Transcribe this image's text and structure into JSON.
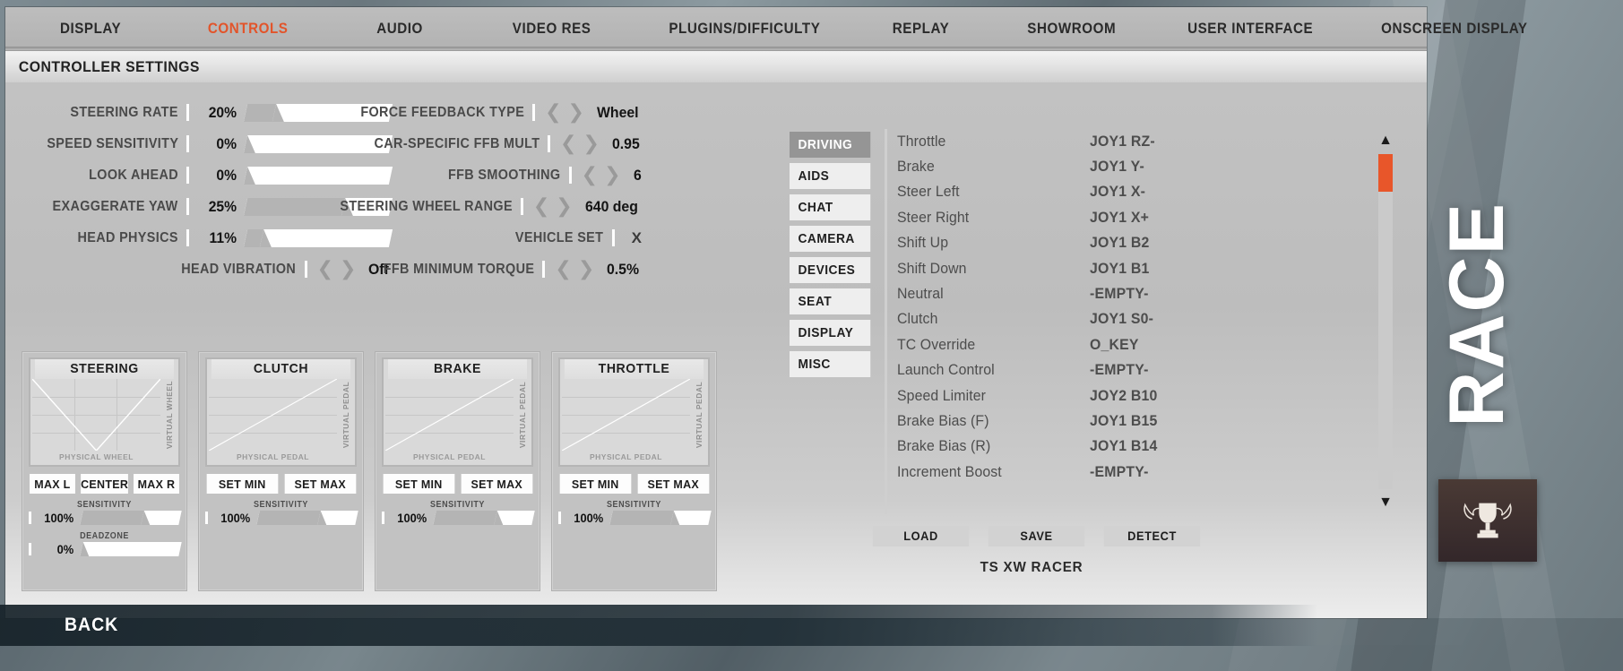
{
  "tabs": [
    {
      "label": "DISPLAY",
      "active": false
    },
    {
      "label": "CONTROLS",
      "active": true
    },
    {
      "label": "AUDIO",
      "active": false
    },
    {
      "label": "VIDEO RES",
      "active": false
    },
    {
      "label": "PLUGINS/DIFFICULTY",
      "active": false
    },
    {
      "label": "REPLAY",
      "active": false
    },
    {
      "label": "SHOWROOM",
      "active": false
    },
    {
      "label": "USER INTERFACE",
      "active": false
    },
    {
      "label": "ONSCREEN DISPLAY",
      "active": false
    }
  ],
  "header": {
    "title": "CONTROLLER SETTINGS"
  },
  "settings_left": [
    {
      "label": "STEERING RATE",
      "value": "20%",
      "percent": 20,
      "type": "slider"
    },
    {
      "label": "SPEED SENSITIVITY",
      "value": "0%",
      "percent": 0,
      "type": "slider"
    },
    {
      "label": "LOOK AHEAD",
      "value": "0%",
      "percent": 0,
      "type": "slider"
    },
    {
      "label": "EXAGGERATE YAW",
      "value": "25%",
      "percent": 25,
      "type": "slider"
    },
    {
      "label": "HEAD PHYSICS",
      "value": "11%",
      "percent": 11,
      "type": "slider"
    },
    {
      "label": "HEAD VIBRATION",
      "value": "Off",
      "type": "stepper"
    }
  ],
  "settings_right": [
    {
      "label": "FORCE FEEDBACK TYPE",
      "value": "Wheel",
      "type": "stepper"
    },
    {
      "label": "CAR-SPECIFIC FFB MULT",
      "value": "0.95",
      "type": "stepper"
    },
    {
      "label": "FFB SMOOTHING",
      "value": "6",
      "type": "stepper"
    },
    {
      "label": "STEERING WHEEL RANGE",
      "value": "640 deg",
      "type": "stepper"
    },
    {
      "label": "VEHICLE SET",
      "value": "X",
      "type": "toggle"
    },
    {
      "label": "FFB MINIMUM TORQUE",
      "value": "0.5%",
      "type": "stepper"
    }
  ],
  "calibration": [
    {
      "title": "STEERING",
      "y_axis": "VIRTUAL WHEEL",
      "x_axis": "PHYSICAL WHEEL",
      "curve": "v-shape",
      "buttons": [
        "MAX L",
        "CENTER",
        "MAX R"
      ],
      "sliders": [
        {
          "label": "SENSITIVITY",
          "value": "100%",
          "percent": 100
        },
        {
          "label": "DEADZONE",
          "value": "0%",
          "percent": 0
        }
      ]
    },
    {
      "title": "CLUTCH",
      "y_axis": "VIRTUAL PEDAL",
      "x_axis": "PHYSICAL PEDAL",
      "curve": "linear",
      "buttons": [
        "SET MIN",
        "SET MAX"
      ],
      "sliders": [
        {
          "label": "SENSITIVITY",
          "value": "100%",
          "percent": 100
        }
      ]
    },
    {
      "title": "BRAKE",
      "y_axis": "VIRTUAL PEDAL",
      "x_axis": "PHYSICAL PEDAL",
      "curve": "linear",
      "buttons": [
        "SET MIN",
        "SET MAX"
      ],
      "sliders": [
        {
          "label": "SENSITIVITY",
          "value": "100%",
          "percent": 100
        }
      ]
    },
    {
      "title": "THROTTLE",
      "y_axis": "VIRTUAL PEDAL",
      "x_axis": "PHYSICAL PEDAL",
      "curve": "linear",
      "buttons": [
        "SET MIN",
        "SET MAX"
      ],
      "sliders": [
        {
          "label": "SENSITIVITY",
          "value": "100%",
          "percent": 100
        }
      ]
    }
  ],
  "categories": [
    {
      "label": "DRIVING",
      "active": true
    },
    {
      "label": "AIDS",
      "active": false
    },
    {
      "label": "CHAT",
      "active": false
    },
    {
      "label": "CAMERA",
      "active": false
    },
    {
      "label": "DEVICES",
      "active": false
    },
    {
      "label": "SEAT",
      "active": false
    },
    {
      "label": "DISPLAY",
      "active": false
    },
    {
      "label": "MISC",
      "active": false
    }
  ],
  "bindings": [
    {
      "action": "Throttle",
      "binding": "JOY1 RZ-"
    },
    {
      "action": "Brake",
      "binding": "JOY1 Y-"
    },
    {
      "action": "Steer Left",
      "binding": "JOY1 X-"
    },
    {
      "action": "Steer Right",
      "binding": "JOY1 X+"
    },
    {
      "action": "Shift Up",
      "binding": "JOY1 B2"
    },
    {
      "action": "Shift Down",
      "binding": "JOY1 B1"
    },
    {
      "action": "Neutral",
      "binding": "-EMPTY-"
    },
    {
      "action": "Clutch",
      "binding": "JOY1 S0-"
    },
    {
      "action": "TC Override",
      "binding": "O_KEY"
    },
    {
      "action": "Launch Control",
      "binding": "-EMPTY-"
    },
    {
      "action": "Speed Limiter",
      "binding": "JOY2 B10"
    },
    {
      "action": "Brake Bias (F)",
      "binding": "JOY1 B15"
    },
    {
      "action": "Brake Bias (R)",
      "binding": "JOY1 B14"
    },
    {
      "action": "Increment Boost",
      "binding": "-EMPTY-"
    }
  ],
  "scrollbar": {
    "up_icon": "chevron-up-icon",
    "down_icon": "chevron-down-icon",
    "thumb_color": "#e8562a"
  },
  "actions": [
    {
      "label": "LOAD"
    },
    {
      "label": "SAVE"
    },
    {
      "label": "DETECT"
    }
  ],
  "device_name": "TS XW RACER",
  "back_button": "BACK",
  "branding": {
    "logo": "RACE",
    "trophy_icon": "trophy-icon"
  },
  "colors": {
    "accent": "#e2542a",
    "scroll_thumb": "#e8562a",
    "panel": "#b9b9b9"
  }
}
